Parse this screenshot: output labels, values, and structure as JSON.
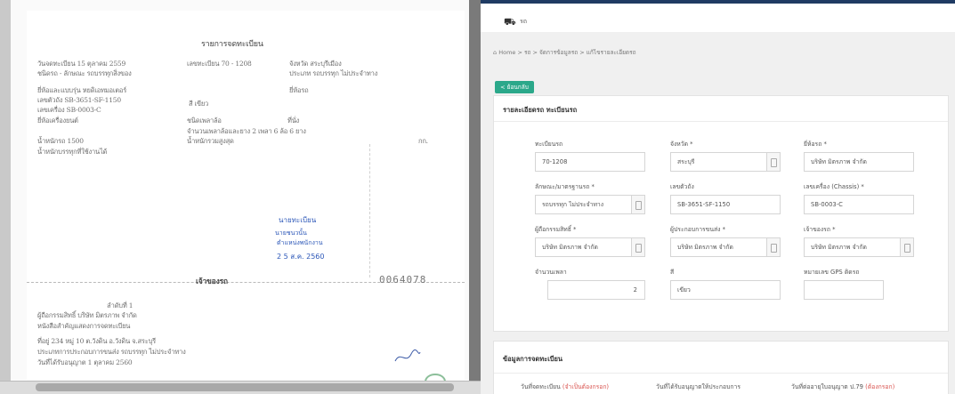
{
  "document": {
    "title": "รายการจดทะเบียน",
    "lines": [
      {
        "text": "วันจดทะเบียน   15 ตุลาคม 2559",
        "x": ": "
      },
      {
        "text": "เลขทะเบียน   70 - 1208"
      },
      {
        "text": "จังหวัด  สระบุรีเมือง"
      },
      {
        "text": "ชนิดรถ   -    ลักษณะ  รถบรรทุกสิ่งของ"
      },
      {
        "text": "ประเภท  รถบรรทุก ไม่ประจำทาง"
      },
      {
        "text": "ยี่ห้อรถ"
      },
      {
        "text": "ยี่ห้อและแบบรุ่น  หยดิเอทมอเตอร์"
      },
      {
        "text": "เลขตัวถัง  SB-3651-SF-1150"
      },
      {
        "text": "เลขเครื่อง  SB-0003-C"
      },
      {
        "text": "สี  เขียว"
      },
      {
        "text": "ยี่ห้อเครื่องยนต์"
      },
      {
        "text": "ชนิดเพลาล้อ"
      },
      {
        "text": "จำนวนเพลาล้อและยาง  2  เพลา  6  ล้อ  6  ยาง"
      },
      {
        "text": "ที่นั่ง"
      },
      {
        "text": "น้ำหนักรถ  1500"
      },
      {
        "text": "น้ำหนักรวมสูงสุด"
      },
      {
        "text": "กก."
      },
      {
        "text": "น้ำหนักบรรทุกที่ใช้งานได้"
      }
    ],
    "stamp_lines": [
      "นายทะเบียน",
      "นายชนวนั้น",
      "ตำแหน่งพนักงาน",
      "2 5 ส.ค. 2560"
    ],
    "owner_title": "เจ้าของรถ",
    "owner_lines": [
      "ลำดับที่   1",
      "ผู้ถือกรรมสิทธิ์  บริษัท มิตรภาพ จำกัด",
      "หนังสือสำคัญแสดงการจดทะเบียน",
      "ที่อยู่  234  หมู่ 10  ต.วังดิน  อ.วังดิน  จ.สระบุรี",
      "ประเภทการประกอบการขนส่ง  รถบรรทุก ไม่ประจำทาง",
      "วันที่ได้รับอนุญาต   1  ตุลาคม 2560"
    ],
    "serial": "0064078"
  },
  "app": {
    "title": "รถ",
    "breadcrumb": "Home  >  รถ  >  จัดการข้อมูลรถ  >  แก้ไขรายละเอียดรถ",
    "back_label": "< ย้อนกลับ",
    "section1_title": "รายละเอียดรถ ทะเบียนรถ",
    "fields": {
      "plate_label": "ทะเบียนรถ",
      "plate_value": "70-1208",
      "province_label": "จังหวัด *",
      "province_value": "สระบุรี",
      "brand_label": "ยี่ห้อรถ *",
      "brand_value": "บริษัท มิตรภาพ จำกัด",
      "type_label": "ลักษณะ/มาตรฐานรถ *",
      "type_value": "รถบรรทุก ไม่ประจำทาง",
      "chassis_label": "เลขตัวถัง",
      "chassis_value": "SB-3651-SF-1150",
      "engine_label": "เลขเครื่อง (Chassis) *",
      "engine_value": "SB-0003-C",
      "owner_label": "ผู้ถือกรรมสิทธิ์ *",
      "owner_value": "บริษัท มิตรภาพ จำกัด",
      "operator_label": "ผู้ประกอบการขนส่ง *",
      "operator_value": "บริษัท มิตรภาพ จำกัด",
      "holder_label": "เจ้าของรถ *",
      "holder_value": "บริษัท มิตรภาพ จำกัด",
      "axle_label": "จำนวนเพลา",
      "axle_value": "2",
      "color_label": "สี",
      "color_value": "เขียว",
      "gps_label": "หมายเลข GPS ติดรถ",
      "gps_value": ""
    },
    "section2_title": "ข้อมูลการจดทะเบียน",
    "section2_labels": [
      {
        "text": "วันที่จดทะเบียน",
        "req": "(จำเป็นต้องกรอก)"
      },
      {
        "text": "วันที่ได้รับอนุญาตให้ประกอบการ",
        "req": ""
      },
      {
        "text": "วันที่ต่ออายุใบอนุญาต ป.79",
        "req": "(ต้องกรอก)"
      }
    ],
    "accent_color": "#2ba88a",
    "header_color": "#1f3b63"
  }
}
